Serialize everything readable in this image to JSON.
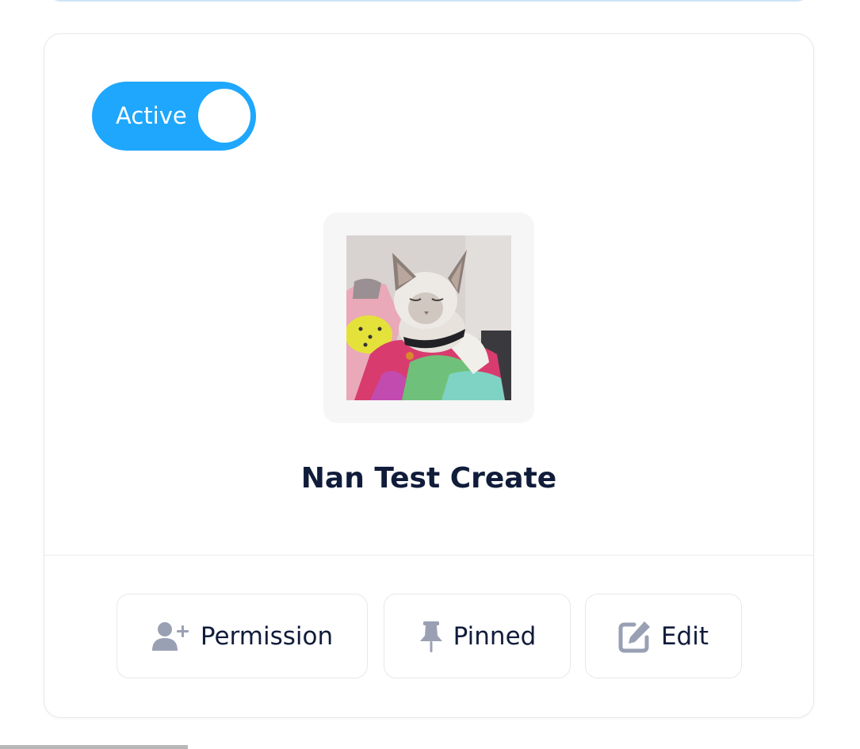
{
  "status_toggle": {
    "label": "Active",
    "state": "on",
    "color": "#1ea7fd"
  },
  "profile": {
    "name": "Nan Test Create",
    "image_alt": "cat-photo"
  },
  "actions": {
    "permission_label": "Permission",
    "pinned_label": "Pinned",
    "edit_label": "Edit"
  },
  "icons": {
    "permission": "user-plus-icon",
    "pinned": "thumbtack-icon",
    "edit": "pen-to-square-icon"
  },
  "colors": {
    "text": "#101c3a",
    "icon": "#9aa0b4",
    "accent": "#1ea7fd"
  }
}
